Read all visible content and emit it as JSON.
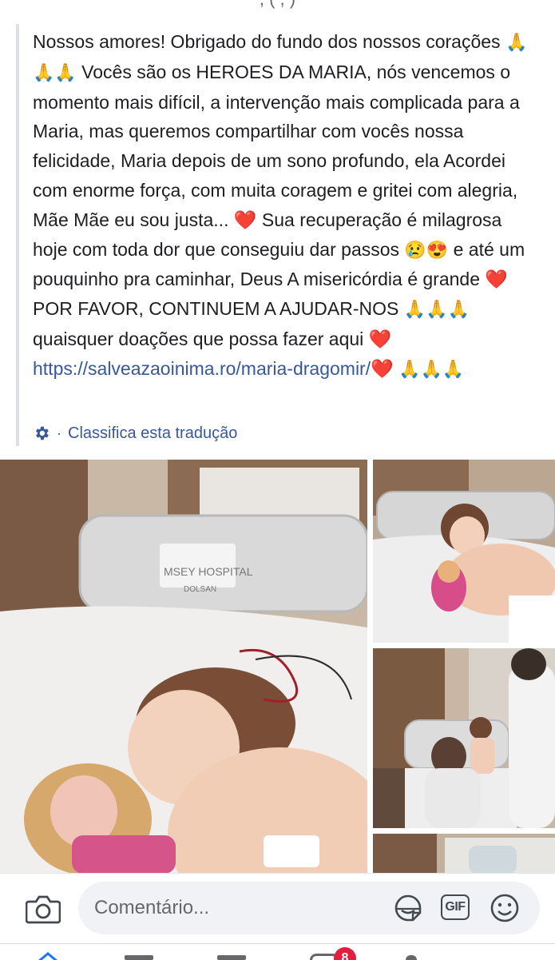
{
  "post": {
    "text_parts": {
      "p1": "Nossos amores! Obrigado do fundo dos nossos corações ",
      "pray1": "🙏🙏🙏",
      "p2": " Vocês são os HEROES DA MARIA, nós vencemos o momento mais difícil, a intervenção mais complicada para a Maria, mas queremos compartilhar com vocês nossa felicidade, Maria depois de um sono profundo, ela Acordei com enorme força, com muita coragem e gritei com alegria, Mãe Mãe eu sou justa... ",
      "heart1": "❤️",
      "p3": " Sua recuperação é milagrosa hoje com toda dor que conseguiu dar passos ",
      "faces": "😢😍",
      "p4": " e até um pouquinho pra caminhar, Deus A misericórdia é grande ",
      "heart2": "❤️",
      "p5": " POR FAVOR, CONTINUEM A AJUDAR-NOS ",
      "pray2": "🙏🙏🙏",
      "p6": " quaisquer doações que possa fazer aqui ",
      "heart3": "❤️",
      "link": "https://salveazaoinima.ro/maria-dragomir/",
      "heart4": "❤️",
      "pray3": "🙏🙏🙏"
    },
    "translation_label": "Classifica esta tradução",
    "translation_separator": "·",
    "photos_sign_text": "MSEY HOSPITAL",
    "photos_sign_sub": "DOLSAN"
  },
  "composer": {
    "placeholder": "Comentário...",
    "gif_label": "GIF"
  },
  "tabbar": {
    "notification_count": "8"
  },
  "icons": {
    "camera": "camera-icon",
    "sticker": "sticker-icon",
    "gif": "gif-icon",
    "emoji": "emoji-icon",
    "settings": "gear-icon"
  },
  "colors": {
    "link": "#385898",
    "heart": "#e41e3f",
    "badge": "#e41e3f"
  }
}
